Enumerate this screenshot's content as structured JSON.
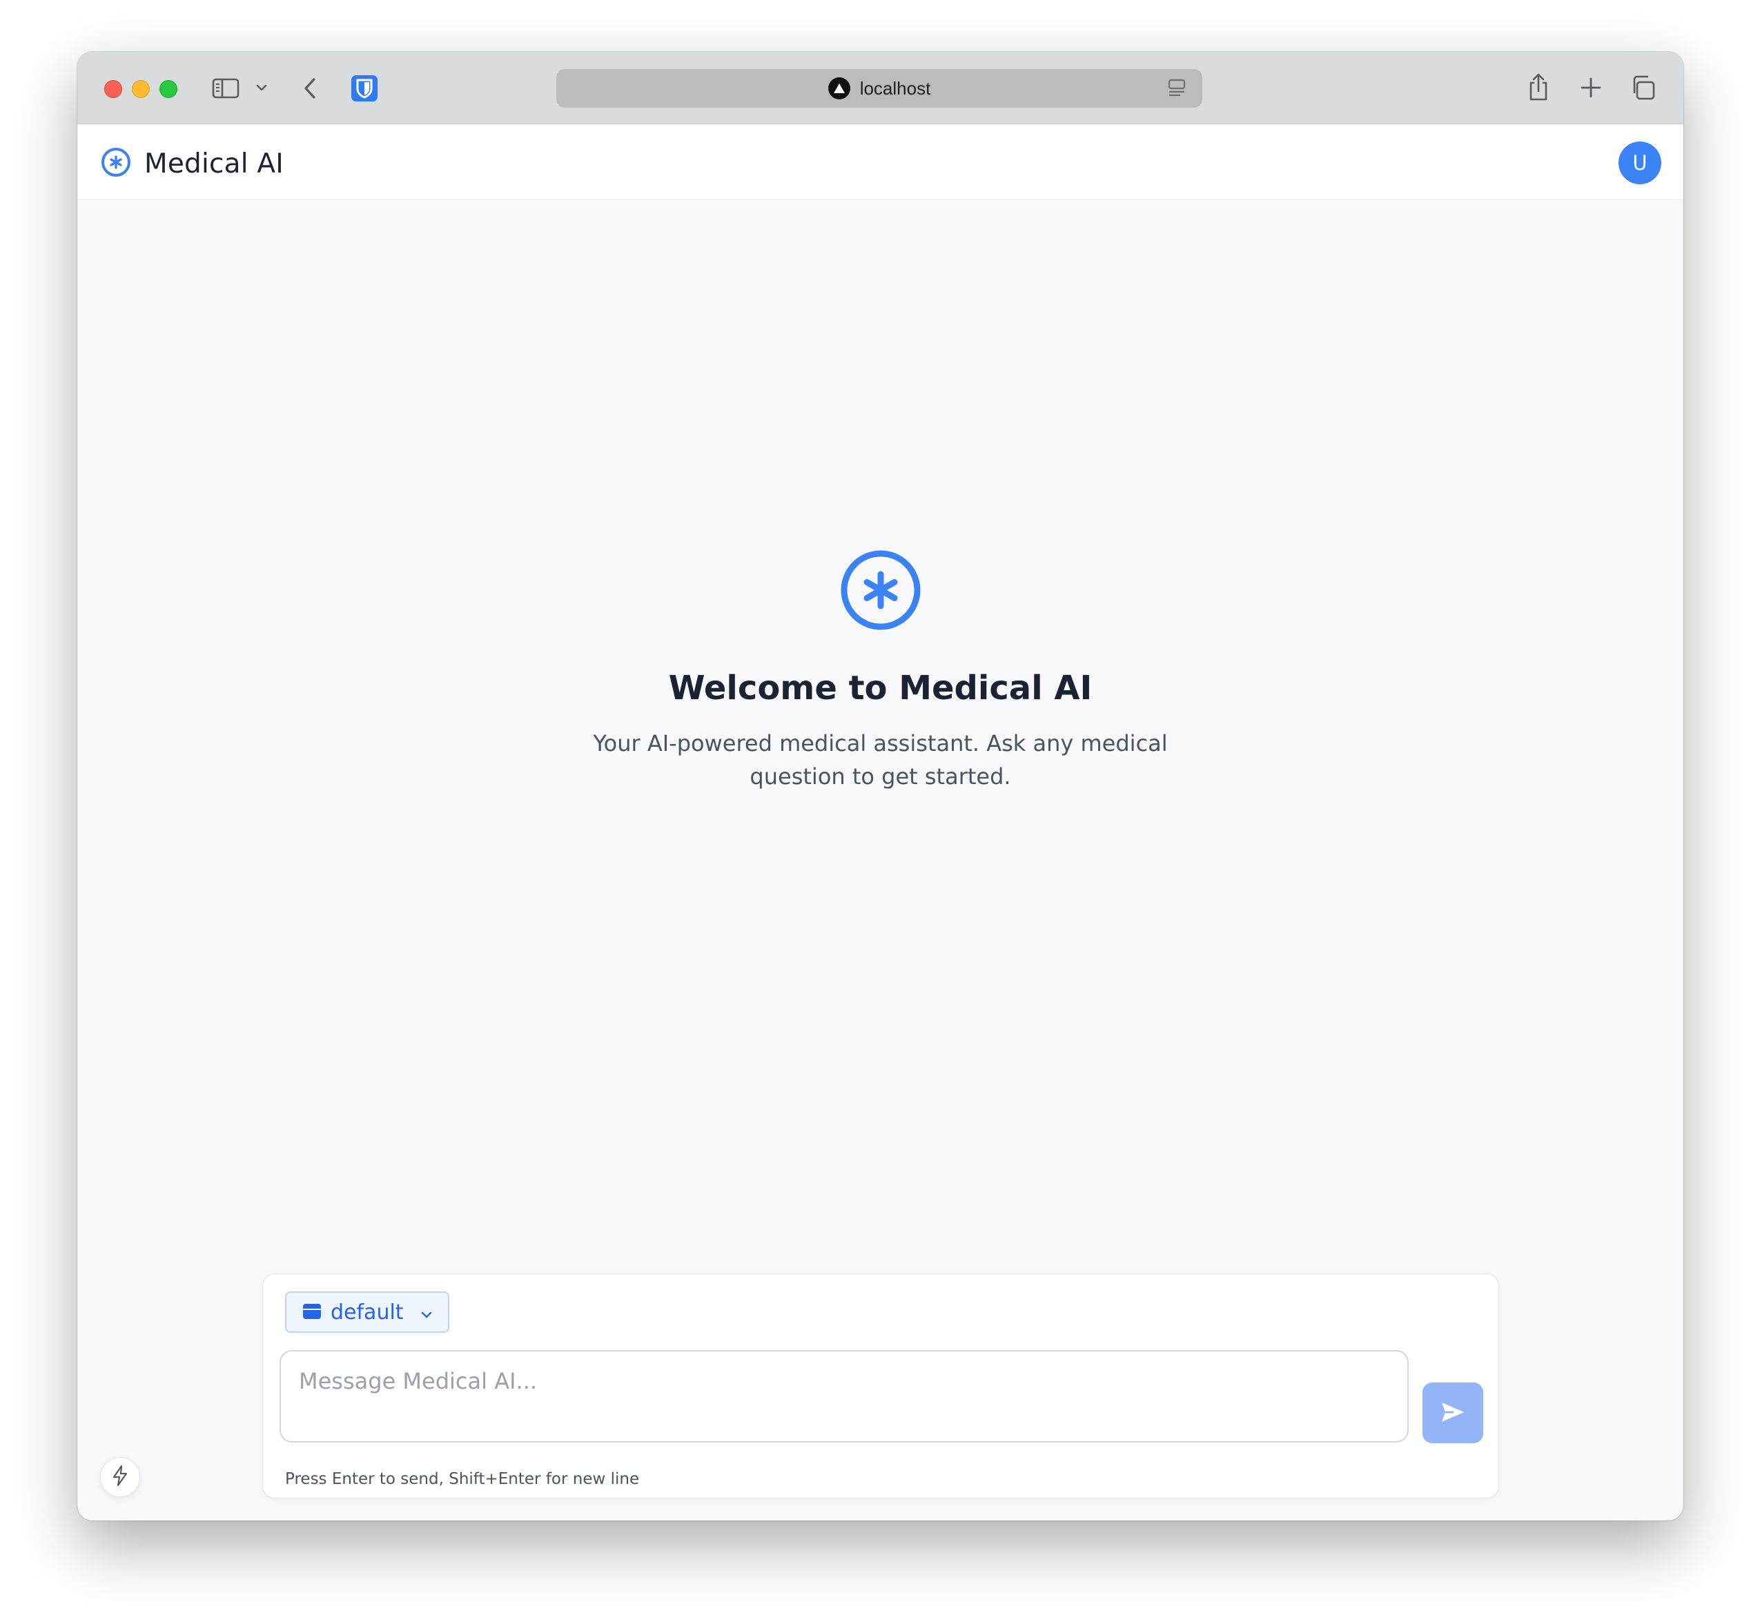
{
  "browser": {
    "url": "localhost",
    "icons": [
      "sidebar-icon",
      "chevron-down-icon",
      "back-icon",
      "bitwarden-icon",
      "reader-icon",
      "share-icon",
      "new-tab-icon",
      "tab-overview-icon"
    ]
  },
  "header": {
    "title": "Medical AI",
    "avatar_initial": "U",
    "logo_icon": "medical-asterisk-icon"
  },
  "welcome": {
    "title": "Welcome to Medical AI",
    "subtitle": "Your AI-powered medical assistant. Ask any medical question to get started.",
    "icon": "medical-asterisk-icon"
  },
  "composer": {
    "model_selected": "default",
    "placeholder": "Message Medical AI...",
    "value": "",
    "hint": "Press Enter to send, Shift+Enter for new line",
    "send_icon": "send-icon"
  },
  "colors": {
    "accent": "#3b82f6",
    "send_disabled": "#93b4f6",
    "background": "#f8f9fb"
  }
}
